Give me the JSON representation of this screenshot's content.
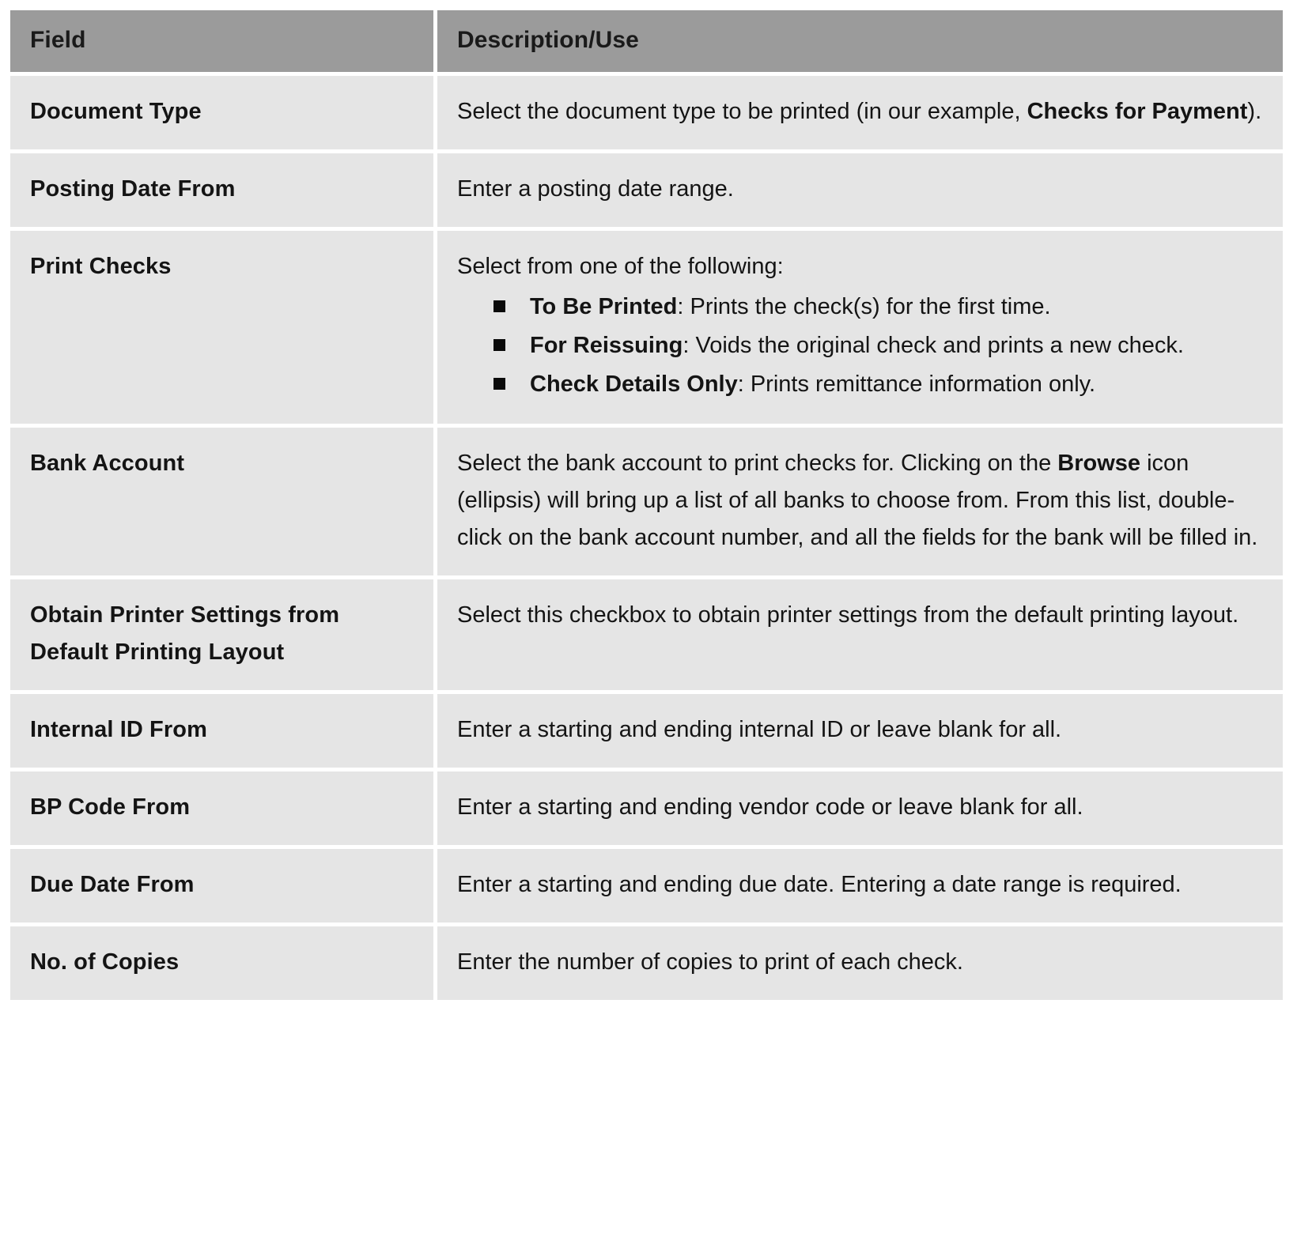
{
  "table": {
    "columns": [
      "Field",
      "Description/Use"
    ],
    "header_bg": "#9b9b9b",
    "cell_bg": "#e5e5e5",
    "rows": [
      {
        "field": "Document Type",
        "desc_lead": "Select the document type to be printed (in our example, ",
        "desc_bold": "Checks for Payment",
        "desc_tail": ")."
      },
      {
        "field": "Posting Date From",
        "desc": "Enter a posting date range."
      },
      {
        "field": "Print Checks",
        "intro": "Select from one of the following:",
        "bullets": [
          {
            "term": "To Be Printed",
            "text": ": Prints the check(s) for the first time."
          },
          {
            "term": "For Reissuing",
            "text": ": Voids the original check and prints a new check."
          },
          {
            "term": "Check Details Only",
            "text": ": Prints remittance information only."
          }
        ]
      },
      {
        "field": "Bank Account",
        "desc_lead": "Select the bank account to print checks for. Clicking on the ",
        "desc_bold": "Browse",
        "desc_tail": " icon (ellipsis) will bring up a list of all banks to choose from. From this list, double-click on the bank account number, and all the fields for the bank will be filled in."
      },
      {
        "field_line1": "Obtain Printer Settings from",
        "field_line2": "Default Printing Layout",
        "desc": "Select this checkbox to obtain printer settings from the default printing layout."
      },
      {
        "field": "Internal ID From",
        "desc": "Enter a starting and ending internal ID or leave blank for all."
      },
      {
        "field": "BP Code From",
        "desc": "Enter a starting and ending vendor code or leave blank for all."
      },
      {
        "field": "Due Date From",
        "desc": "Enter a starting and ending due date. Entering a date range is required."
      },
      {
        "field": "No. of Copies",
        "desc": "Enter the number of copies to print of each check."
      }
    ]
  }
}
